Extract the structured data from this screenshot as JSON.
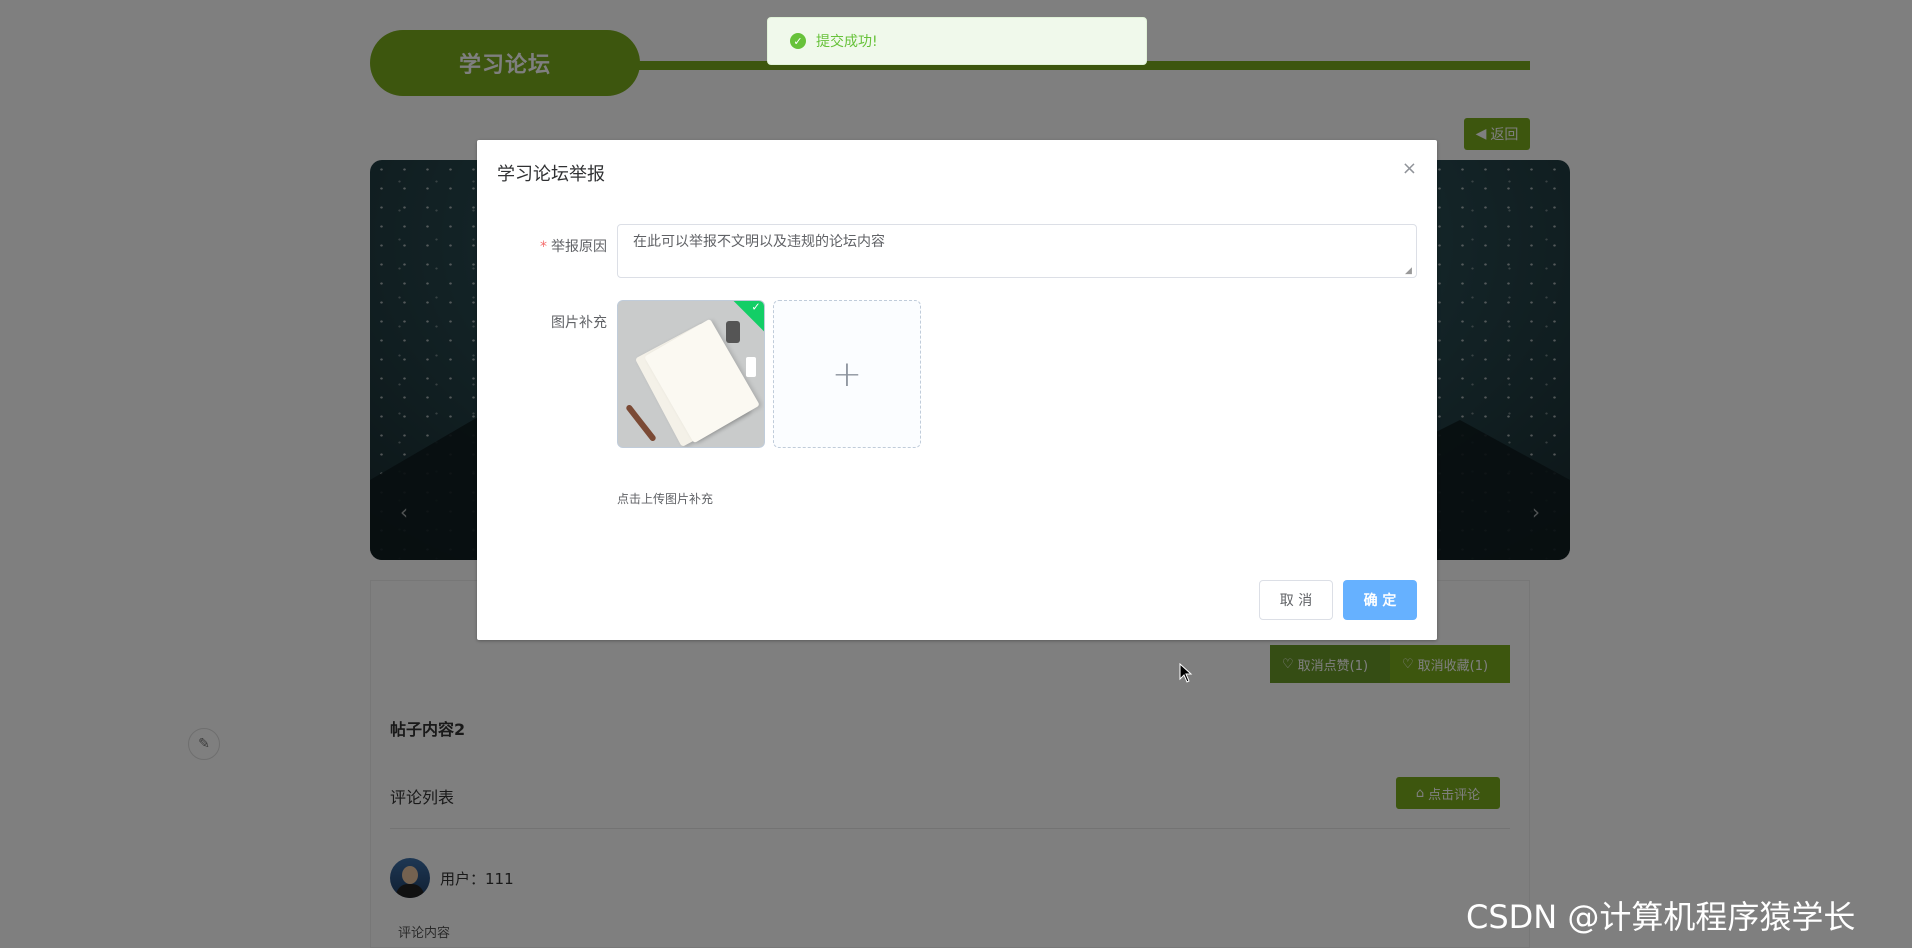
{
  "page": {
    "title": "学习论坛",
    "back_label": "返回",
    "like_label": "取消点赞(1)",
    "favorite_label": "取消收藏(1)",
    "post_content": "帖子内容2",
    "comments_heading": "评论列表",
    "comment_button": "点击评论",
    "comment_user": "用户：111",
    "comment_text": "评论内容",
    "carousel_prev": "‹",
    "carousel_next": "›"
  },
  "toast": {
    "message": "提交成功!",
    "type": "success"
  },
  "dialog": {
    "title": "学习论坛举报",
    "close_label": "×",
    "reason_label": "举报原因",
    "reason_required_mark": "*",
    "reason_value": "在此可以举报不文明以及违规的论坛内容",
    "image_label": "图片补充",
    "upload_plus": "+",
    "upload_tip": "点击上传图片补充",
    "cancel_label": "取 消",
    "confirm_label": "确 定"
  },
  "watermark": "CSDN @计算机程序猿学长",
  "colors": {
    "accent_green": "#7aac1c",
    "primary_blue": "#66b1ff",
    "success_green": "#67c23a",
    "required_red": "#f56c6c"
  },
  "icons": {
    "back": "caret-left-icon",
    "like": "heart-icon",
    "favorite": "heart-icon",
    "comment": "home-icon",
    "toast": "check-circle-icon",
    "close": "close-icon",
    "upload": "plus-icon",
    "side": "edit-icon"
  }
}
